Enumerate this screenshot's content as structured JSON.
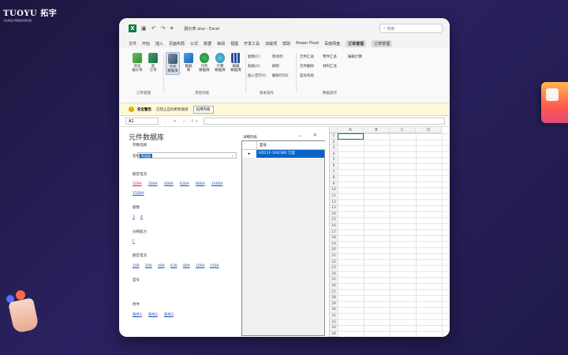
{
  "brand": {
    "name": "TUOYU 拓宇",
    "tagline": "为全球设计师提供无限可能"
  },
  "window": {
    "title": "报价表.xlsx - Excel",
    "search_placeholder": "搜索"
  },
  "menu": [
    {
      "label": "文件"
    },
    {
      "label": "开始"
    },
    {
      "label": "插入"
    },
    {
      "label": "页面布局"
    },
    {
      "label": "公式"
    },
    {
      "label": "数据"
    },
    {
      "label": "审阅"
    },
    {
      "label": "视图"
    },
    {
      "label": "开发工具"
    },
    {
      "label": "加载项"
    },
    {
      "label": "帮助"
    },
    {
      "label": "Power Pivot"
    },
    {
      "label": "百度网盘"
    },
    {
      "label": "订单管理"
    },
    {
      "label": "订单管理"
    }
  ],
  "ribbon": {
    "group1": {
      "label": "订单管理",
      "btn1": "浏览\n报价单",
      "btn2": "新\n订单"
    },
    "group2": {
      "label": "其他功能",
      "btn1": "元件\n数据库",
      "btn2": "数据\n库",
      "btn3": "元件\n数据库",
      "btn4": "计算\n数据库",
      "btn5": "编辑\n数据库"
    },
    "group3": {
      "label": "基本操作",
      "items": [
        "复制(C)",
        "移动列",
        "粘贴(V)",
        "刷新",
        "插入空行(I)",
        "删除行(D)"
      ]
    },
    "group4": {
      "label": "数据操作",
      "items": [
        "元件汇总",
        "零件汇总",
        "元件删除",
        "材料汇总",
        "型号校验"
      ]
    },
    "group5": {
      "items": [
        "编辑计算"
      ]
    }
  },
  "security_bar": {
    "title": "安全警告",
    "message": "已禁止自动更新链接",
    "button": "启用内容"
  },
  "formula_bar": {
    "name_box": "A1",
    "fx": "fx"
  },
  "pane": {
    "title": "元件数据库",
    "section_label": "参数选择",
    "name_label": "名称",
    "name_value": "断路器",
    "rated_current_label": "额定电流",
    "rated_current_options": [
      "100A",
      "200A",
      "400A",
      "630A",
      "800A",
      "1000A",
      "1500A"
    ],
    "poles_label": "极数",
    "poles_options": [
      "3",
      "4"
    ],
    "breaking_label": "分断能力",
    "breaking_options": [
      "F"
    ],
    "frame_current_label": "额定电流",
    "frame_current_options": [
      "100",
      "200",
      "400",
      "630",
      "800",
      "1000",
      "1500"
    ],
    "model_label": "型号",
    "accessory_label": "附件",
    "accessory_options": [
      "附件1",
      "附件2",
      "附件3"
    ],
    "details_label": "详细列表",
    "grid_header": "型号",
    "grid_row": "HD11F-100/380 刀型"
  },
  "sheet": {
    "columns": [
      "A",
      "B",
      "C",
      "D"
    ],
    "rows": [
      "1",
      "2",
      "3",
      "4",
      "5",
      "6",
      "7",
      "8",
      "9",
      "10",
      "11",
      "12",
      "13",
      "14",
      "15",
      "16",
      "17",
      "18",
      "19",
      "20",
      "21",
      "22",
      "23",
      "24",
      "25",
      "26",
      "27",
      "28",
      "29",
      "30",
      "31",
      "32",
      "33",
      "34"
    ]
  }
}
